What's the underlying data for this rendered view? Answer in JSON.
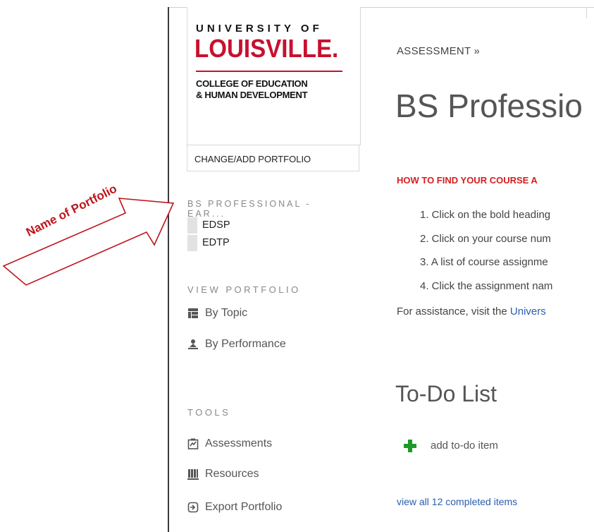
{
  "logo": {
    "line1": "UNIVERSITY OF",
    "line2": "LOUISVILLE.",
    "line3": "COLLEGE OF EDUCATION",
    "line4": "& HUMAN DEVELOPMENT"
  },
  "sidebar": {
    "change_button": "CHANGE/ADD PORTFOLIO",
    "portfolio_name_line1": "BS PROFESSIONAL -",
    "portfolio_name_line2": "EAR...",
    "sub_items": [
      {
        "label": "EDSP"
      },
      {
        "label": "EDTP"
      }
    ],
    "view_heading": "VIEW PORTFOLIO",
    "view_items": [
      {
        "label": "By Topic",
        "icon": "table-icon"
      },
      {
        "label": "By Performance",
        "icon": "person-icon"
      }
    ],
    "tools_heading": "TOOLS",
    "tools_items": [
      {
        "label": "Assessments",
        "icon": "clipboard-chart-icon"
      },
      {
        "label": "Resources",
        "icon": "books-icon"
      },
      {
        "label": "Export Portfolio",
        "icon": "export-icon"
      }
    ]
  },
  "main": {
    "breadcrumb": "ASSESSMENT",
    "breadcrumb_sep": "»",
    "title": "BS Professio",
    "howto": "HOW TO FIND YOUR COURSE A",
    "steps": [
      "1. Click on the bold heading",
      "2. Click on your course num",
      "3. A list of course assignme",
      "4. Click the assignment nam"
    ],
    "assist_prefix": "For assistance, visit the ",
    "assist_link": "Univers",
    "todo_title": "To-Do List",
    "add_todo": "add to-do item",
    "completed_link": "view all 12 completed items"
  },
  "annotation": {
    "label": "Name of Portfolio",
    "color": "#c0141c"
  },
  "colors": {
    "brand_red": "#c8102e",
    "link_blue": "#2a5db0",
    "howto_red": "#d61d1d",
    "add_green": "#1e9a2a"
  }
}
